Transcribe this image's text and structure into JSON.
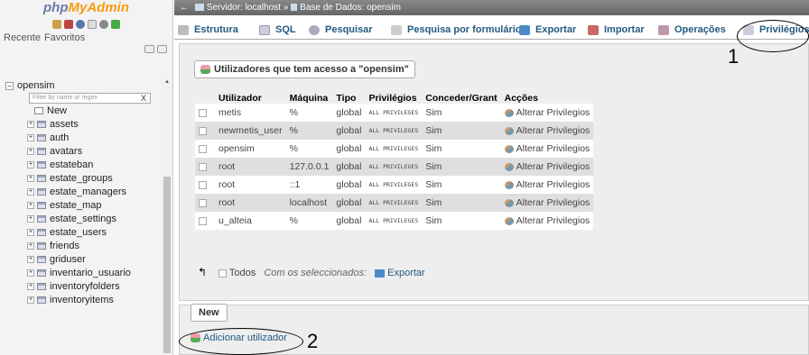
{
  "sidebar": {
    "logo_part1": "php",
    "logo_part2": "MyAdmin",
    "recent_label": "Recente",
    "favorites_label": "Favoritos",
    "database": "opensim",
    "filter_placeholder": "Filter by name or regex",
    "filter_clear": "X",
    "new_label": "New",
    "tables": [
      "assets",
      "auth",
      "avatars",
      "estateban",
      "estate_groups",
      "estate_managers",
      "estate_map",
      "estate_settings",
      "estate_users",
      "friends",
      "griduser",
      "inventario_usuario",
      "inventoryfolders",
      "inventoryitems"
    ]
  },
  "breadcrumb": {
    "server": "Servidor: localhost",
    "separator": "»",
    "database": "Base de Dados: opensim"
  },
  "tabs": [
    {
      "label": "Estrutura",
      "icon": "structure-icon"
    },
    {
      "label": "SQL",
      "icon": "sql-icon"
    },
    {
      "label": "Pesquisar",
      "icon": "search-icon"
    },
    {
      "label": "Pesquisa por formulário",
      "icon": "query-icon"
    },
    {
      "label": "Exportar",
      "icon": "export-icon"
    },
    {
      "label": "Importar",
      "icon": "import-icon"
    },
    {
      "label": "Operações",
      "icon": "operations-icon"
    },
    {
      "label": "Privilégios",
      "icon": "privileges-icon"
    }
  ],
  "users_panel": {
    "legend": "Utilizadores que tem acesso a \"opensim\"",
    "columns": [
      "Utilizador",
      "Máquina",
      "Tipo",
      "Privilégios",
      "Conceder/Grant",
      "Acções"
    ],
    "rows": [
      {
        "user": "metis",
        "host": "%",
        "type": "global",
        "privileges": "ALL PRIVILEGES",
        "grant": "Sim",
        "action": "Alterar Privilegios"
      },
      {
        "user": "newmetis_user",
        "host": "%",
        "type": "global",
        "privileges": "ALL PRIVILEGES",
        "grant": "Sim",
        "action": "Alterar Privilegios"
      },
      {
        "user": "opensim",
        "host": "%",
        "type": "global",
        "privileges": "ALL PRIVILEGES",
        "grant": "Sim",
        "action": "Alterar Privilegios"
      },
      {
        "user": "root",
        "host": "127.0.0.1",
        "type": "global",
        "privileges": "ALL PRIVILEGES",
        "grant": "Sim",
        "action": "Alterar Privilegios"
      },
      {
        "user": "root",
        "host": "::1",
        "type": "global",
        "privileges": "ALL PRIVILEGES",
        "grant": "Sim",
        "action": "Alterar Privilegios"
      },
      {
        "user": "root",
        "host": "localhost",
        "type": "global",
        "privileges": "ALL PRIVILEGES",
        "grant": "Sim",
        "action": "Alterar Privilegios"
      },
      {
        "user": "u_alteia",
        "host": "%",
        "type": "global",
        "privileges": "ALL PRIVILEGES",
        "grant": "Sim",
        "action": "Alterar Privilegios"
      }
    ],
    "check_all_label": "Todos",
    "with_selected_label": "Com os seleccionados:",
    "export_label": "Exportar"
  },
  "new_panel": {
    "legend": "New",
    "add_user_label": "Adicionar utilizador"
  },
  "annotations": {
    "one": "1",
    "two": "2"
  }
}
